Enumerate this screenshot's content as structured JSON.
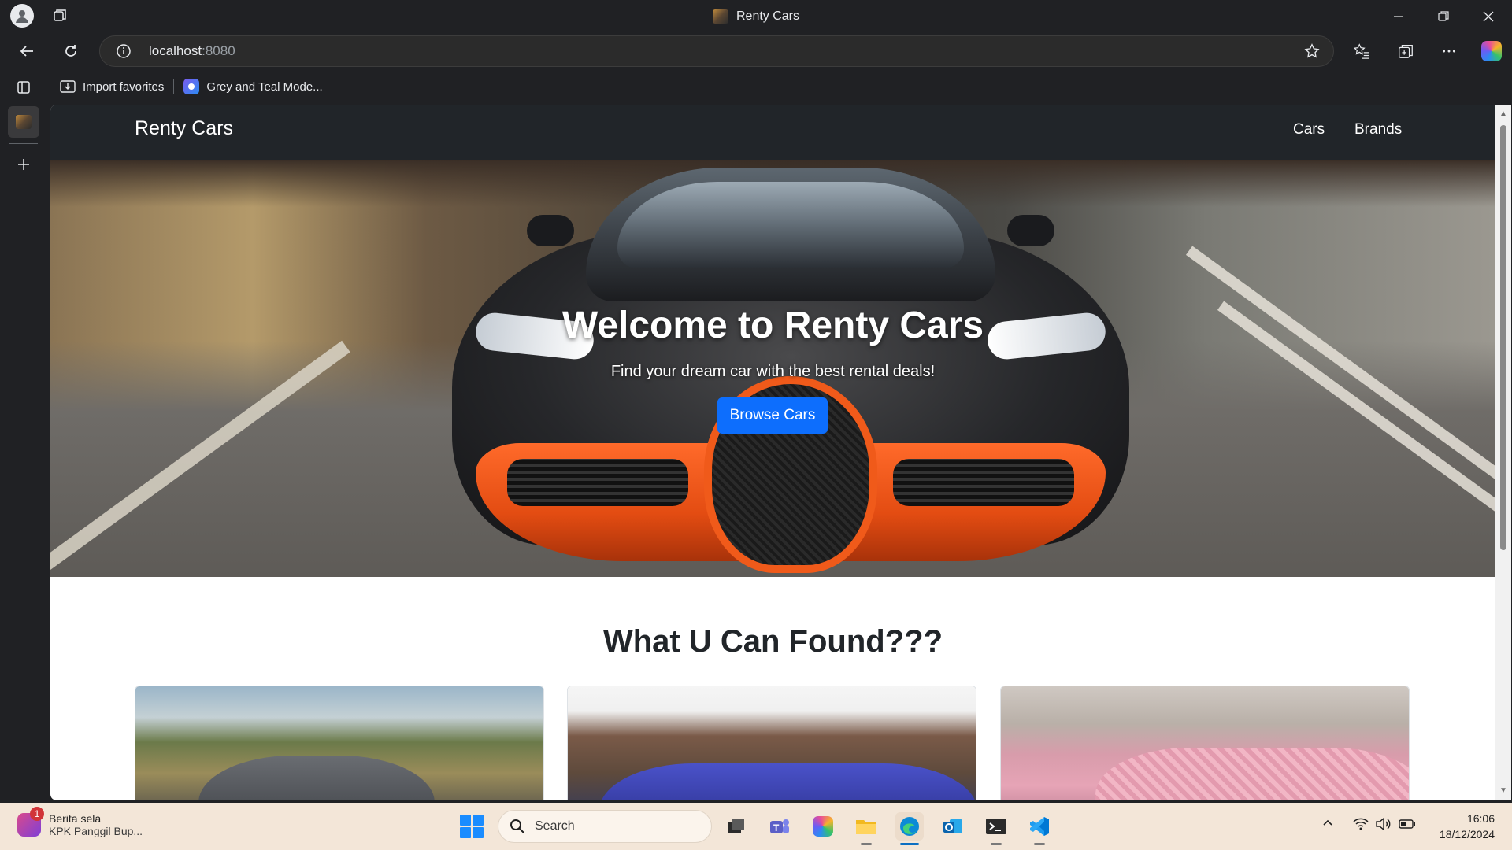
{
  "browser": {
    "window_title": "Renty Cars",
    "url_host": "localhost",
    "url_port": ":8080",
    "favorites": [
      {
        "label": "Import favorites"
      },
      {
        "label": "Grey and Teal Mode..."
      }
    ]
  },
  "site": {
    "brand": "Renty Cars",
    "nav": [
      "Cars",
      "Brands"
    ],
    "hero": {
      "title": "Welcome to Renty Cars",
      "subtitle": "Find your dream car with the best rental deals!",
      "cta": "Browse Cars"
    },
    "section_title": "What U Can Found???"
  },
  "taskbar": {
    "news_badge": "1",
    "news_title": "Berita sela",
    "news_subtitle": "KPK Panggil Bup...",
    "search_placeholder": "Search",
    "time": "16:06",
    "date": "18/12/2024"
  },
  "colors": {
    "primary_button": "#0d6efd",
    "navbar": "#212529",
    "chrome": "#202124",
    "taskbar": "#f3e6d8"
  }
}
